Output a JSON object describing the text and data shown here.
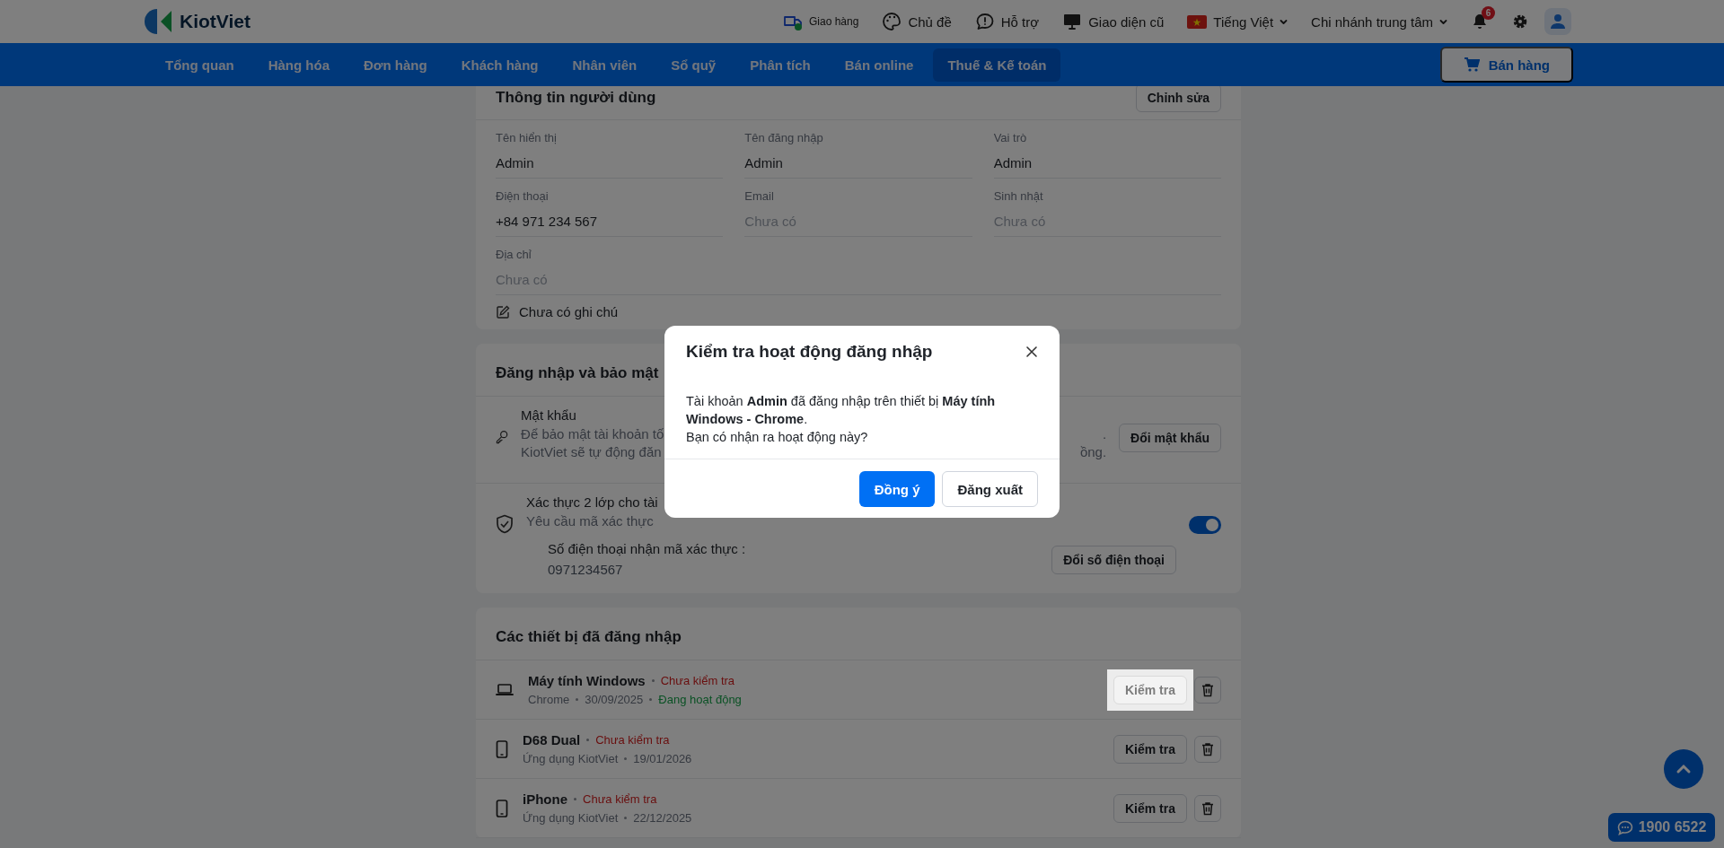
{
  "header": {
    "logo_text": "KiotViet",
    "links": [
      {
        "kind": "delivery",
        "label": "Giao hàng"
      },
      {
        "kind": "theme",
        "label": "Chủ đề"
      },
      {
        "kind": "support",
        "label": "Hỗ trợ"
      },
      {
        "kind": "old_ui",
        "label": "Giao diện cũ"
      }
    ],
    "language": "Tiếng Việt",
    "branch": "Chi nhánh trung tâm",
    "notification_count": "6"
  },
  "nav": {
    "items": [
      {
        "label": "Tổng quan",
        "selected": false
      },
      {
        "label": "Hàng hóa",
        "selected": false
      },
      {
        "label": "Đơn hàng",
        "selected": false
      },
      {
        "label": "Khách hàng",
        "selected": false
      },
      {
        "label": "Nhân viên",
        "selected": false
      },
      {
        "label": "Sổ quỹ",
        "selected": false
      },
      {
        "label": "Phân tích",
        "selected": false
      },
      {
        "label": "Bán online",
        "selected": false
      },
      {
        "label": "Thuế & Kế toán",
        "selected": true
      }
    ],
    "sell_button": "Bán hàng"
  },
  "profile_card": {
    "title": "Thông tin người dùng",
    "edit_button": "Chỉnh sửa",
    "fields": [
      {
        "label": "Tên hiển thị",
        "value": "Admin",
        "empty": false,
        "wide": false
      },
      {
        "label": "Tên đăng nhập",
        "value": "Admin",
        "empty": false,
        "wide": false
      },
      {
        "label": "Vai trò",
        "value": "Admin",
        "empty": false,
        "wide": false
      },
      {
        "label": "Điện thoại",
        "value": "+84 971 234 567",
        "empty": false,
        "wide": false
      },
      {
        "label": "Email",
        "value": "Chưa có",
        "empty": true,
        "wide": false
      },
      {
        "label": "Sinh nhật",
        "value": "Chưa có",
        "empty": true,
        "wide": false
      },
      {
        "label": "Địa chỉ",
        "value": "Chưa có",
        "empty": true,
        "wide": true
      }
    ],
    "note": "Chưa có ghi chú"
  },
  "security_card": {
    "title": "Đăng nhập và bảo mật",
    "items": [
      {
        "kind": "password",
        "title": "Mật khẩu",
        "lines": [
          {
            "left": "Để bảo mật tài khoản tố",
            "right": "."
          },
          {
            "left": "KiotViet sẽ tự động đăn",
            "right": "ồng."
          }
        ],
        "button": "Đổi mật khẩu"
      },
      {
        "kind": "two_factor",
        "title": "Xác thực 2 lớp cho tài",
        "lines": [
          {
            "left": "Yêu cầu mã xác thực"
          }
        ],
        "on": true,
        "phone_label": "Số điện thoại nhận mã xác thực :",
        "phone": "0971234567",
        "button": "Đổi số điện thoại"
      }
    ]
  },
  "devices_card": {
    "title": "Các thiết bị đã đăng nhập",
    "devices": [
      {
        "kind": "laptop",
        "name": "Máy tính Windows",
        "status": "Chưa kiểm tra",
        "meta": [
          "Chrome",
          "30/09/2025"
        ],
        "activity": "Đang hoạt động",
        "button": "Kiểm tra",
        "highlighted": true
      },
      {
        "kind": "phone",
        "name": "D68 Dual",
        "status": "Chưa kiểm tra",
        "meta": [
          "Ứng dụng KiotViet",
          "19/01/2026"
        ],
        "button": "Kiểm tra",
        "highlighted": false
      },
      {
        "kind": "phone",
        "name": "iPhone",
        "status": "Chưa kiểm tra",
        "meta": [
          "Ứng dụng KiotViet",
          "22/12/2025"
        ],
        "button": "Kiểm tra",
        "highlighted": false
      }
    ]
  },
  "modal": {
    "title": "Kiểm tra hoạt động đăng nhập",
    "body_lines": [
      "Tài khoản **Admin** đã đăng nhập trên thiết bị **Máy tính Windows - Chrome**.",
      "Bạn có nhận ra hoạt động này?"
    ],
    "confirm_button": "Đồng ý",
    "logout_button": "Đăng xuất"
  },
  "hotline": "1900 6522"
}
